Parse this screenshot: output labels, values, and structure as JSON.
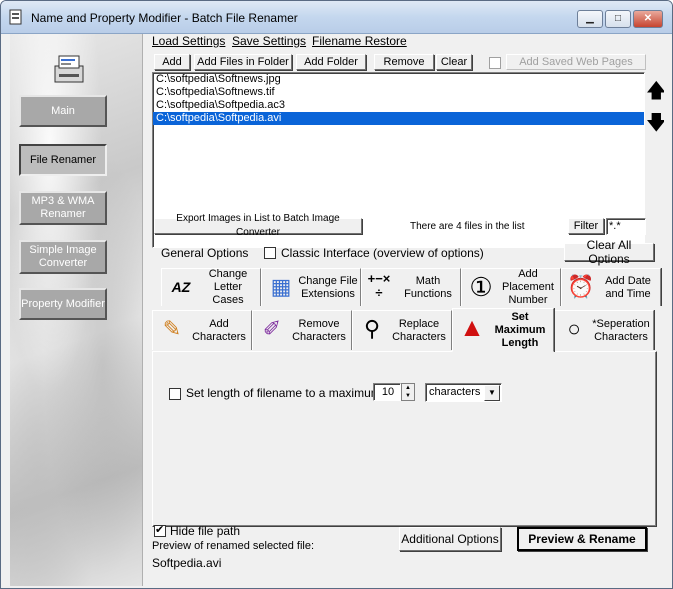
{
  "window": {
    "title": "Name and Property Modifier - Batch File Renamer",
    "controls": {
      "minimize": "▁",
      "maximize": "□",
      "close": "✕"
    }
  },
  "sidebar": {
    "items": [
      {
        "label": "Main",
        "active": false
      },
      {
        "label": "File Renamer",
        "active": true
      },
      {
        "label": "MP3 & WMA Renamer",
        "active": false
      },
      {
        "label": "Simple Image Converter",
        "active": false
      },
      {
        "label": "Property Modifier",
        "active": false
      }
    ]
  },
  "menu": {
    "load": "Load Settings",
    "save": "Save Settings",
    "restore": "Filename Restore"
  },
  "toolbar": {
    "add": "Add",
    "add_files": "Add Files in Folder",
    "add_folder": "Add Folder",
    "remove": "Remove",
    "clear": "Clear",
    "add_web": "Add Saved Web Pages"
  },
  "files": [
    "C:\\softpedia\\Softnews.jpg",
    "C:\\softpedia\\Softnews.tif",
    "C:\\softpedia\\Softpedia.ac3",
    "C:\\softpedia\\Softpedia.avi"
  ],
  "list_footer": {
    "export": "Export Images in List to Batch Image Converter",
    "count_text": "There are 4 files in the list",
    "filter": "Filter",
    "filter_value": "*.*"
  },
  "options": {
    "general": "General Options",
    "classic": "Classic Interface (overview of options)",
    "clear_all": "Clear All Options"
  },
  "tabs_row1": [
    {
      "label": "Change Letter Cases",
      "icon": "AZ"
    },
    {
      "label": "Change File Extensions",
      "icon": "▦"
    },
    {
      "label": "Math Functions",
      "icon": "+−×÷"
    },
    {
      "label": "Add Placement Number",
      "icon": "①"
    },
    {
      "label": "Add Date and Time",
      "icon": "⏰"
    }
  ],
  "tabs_row2": [
    {
      "label": "Add Characters",
      "icon": "✎"
    },
    {
      "label": "Remove Characters",
      "icon": "✐"
    },
    {
      "label": "Replace Characters",
      "icon": "⚲"
    },
    {
      "label": "Set Maximum Length",
      "icon": "▲"
    },
    {
      "label": "*Seperation Characters",
      "icon": "○"
    }
  ],
  "maxlen": {
    "label": "Set length of filename to a maximum of",
    "value": "10",
    "unit": "characters"
  },
  "bottom": {
    "hide_path": "Hide file path",
    "preview_label": "Preview of renamed selected file:",
    "preview_value": "Softpedia.avi",
    "additional": "Additional Options",
    "preview_rename": "Preview & Rename"
  }
}
